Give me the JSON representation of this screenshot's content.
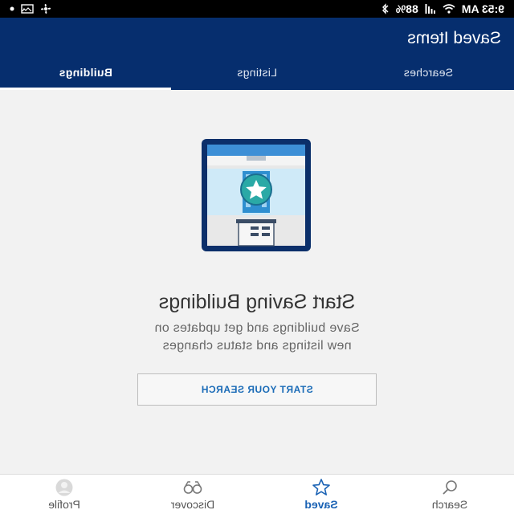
{
  "status_bar": {
    "time": "9:53 AM",
    "battery": "88%"
  },
  "app_bar": {
    "title": "Saved Items"
  },
  "tabs": [
    {
      "label": "Searches",
      "active": false
    },
    {
      "label": "Listings",
      "active": false
    },
    {
      "label": "Buildings",
      "active": true
    }
  ],
  "empty_state": {
    "heading": "Start Saving Buildings",
    "line1": "Save buildings and get updates on",
    "line2": "new listings and status changes",
    "cta_label": "START YOUR SEARCH"
  },
  "bottom_nav": [
    {
      "label": "Search",
      "icon": "search-icon",
      "active": false
    },
    {
      "label": "Saved",
      "icon": "star-icon",
      "active": true
    },
    {
      "label": "Discover",
      "icon": "binoculars-icon",
      "active": false
    },
    {
      "label": "Profile",
      "icon": "avatar-icon",
      "active": false
    }
  ],
  "colors": {
    "header": "#062e6e",
    "accent": "#1a62b4",
    "background": "#f2f2f2"
  }
}
